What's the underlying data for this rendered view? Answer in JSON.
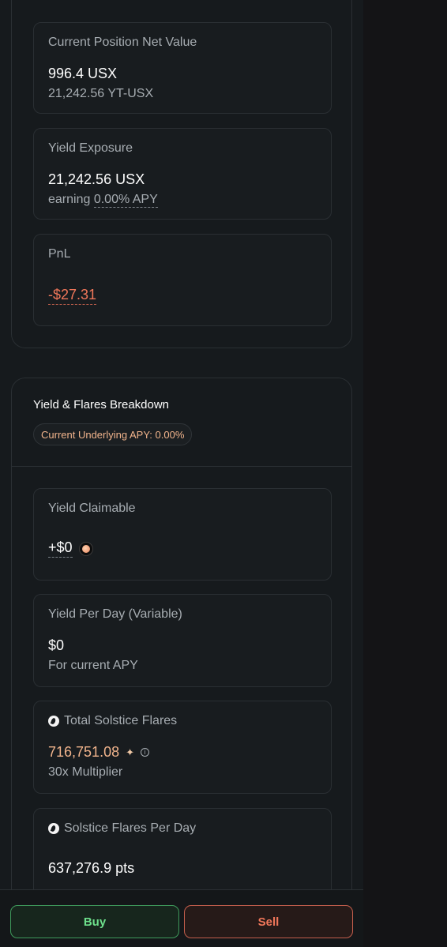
{
  "position": {
    "net_value": {
      "label": "Current Position Net Value",
      "value": "996.4 USX",
      "sub": "21,242.56 YT-USX"
    },
    "yield_exposure": {
      "label": "Yield Exposure",
      "value": "21,242.56 USX",
      "sub_prefix": "earning",
      "sub_apy": "0.00% APY"
    },
    "pnl": {
      "label": "PnL",
      "value": "-$27.31"
    }
  },
  "breakdown": {
    "title": "Yield & Flares Breakdown",
    "apy_badge": "Current Underlying APY: 0.00%",
    "yield_claimable": {
      "label": "Yield Claimable",
      "value": "+$0",
      "icon": "usx-coin-icon"
    },
    "yield_per_day": {
      "label": "Yield Per Day (Variable)",
      "value": "$0",
      "sub": "For current APY"
    },
    "total_flares": {
      "label": "Total Solstice Flares",
      "value": "716,751.08",
      "sub": "30x Multiplier",
      "icon": "solstice-flare-icon"
    },
    "flares_per_day": {
      "label": "Solstice Flares Per Day",
      "value": "637,276.9 pts",
      "icon": "solstice-flare-icon"
    }
  },
  "actions": {
    "buy_label": "Buy",
    "sell_label": "Sell"
  },
  "colors": {
    "negative": "#f0775a",
    "positive": "#6ee08c",
    "accent_orange": "#f1b48c"
  }
}
